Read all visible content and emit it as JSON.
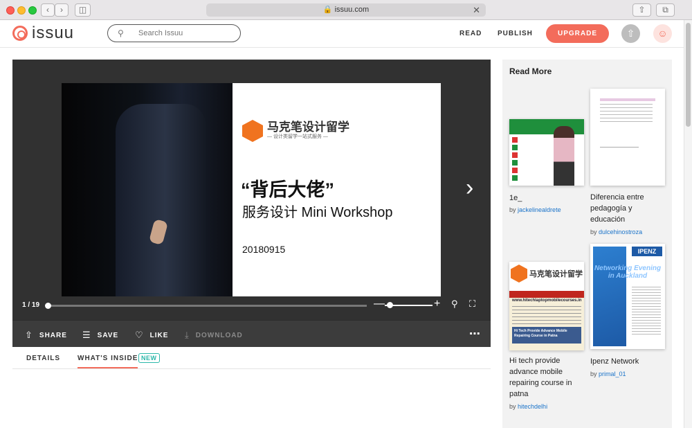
{
  "browser": {
    "url": "issuu.com",
    "lock_icon": "lock-icon"
  },
  "header": {
    "logo": "issuu",
    "search_placeholder": "Search Issuu",
    "nav_read": "READ",
    "nav_publish": "PUBLISH",
    "upgrade_label": "UPGRADE",
    "accent": "#f36c5b"
  },
  "viewer": {
    "slide_brand_title": "马克笔设计留学",
    "slide_brand_sub": "— 设计类留学一站式服务 —",
    "slide_title": "“背后大佬”",
    "slide_subtitle": "服务设计 Mini Workshop",
    "slide_date": "20180915",
    "page_counter": "1 / 19",
    "progress": 0.0
  },
  "toolbar": {
    "share": "SHARE",
    "save": "SAVE",
    "like": "LIKE",
    "download": "DOWNLOAD"
  },
  "tabs": {
    "details": "DETAILS",
    "whats_inside": "WHAT'S INSIDE",
    "new_badge": "NEW"
  },
  "read_more": {
    "heading": "Read More",
    "by_prefix": "by",
    "items": [
      {
        "title": "1e_",
        "author": "jackelinealdrete"
      },
      {
        "title": "Diferencia entre pedagogía y educación",
        "author": "dulcehinostroza"
      },
      {
        "title": "Hi tech provide advance mobile repairing course in patna",
        "author": "hitechdelhi",
        "thumb_top": "马克笔设计留学",
        "thumb_url": "www.hitechlaptopmobilecourses.in",
        "thumb_banner": "Hi Tech Provide Advance Mobile Repairing Course in Patna"
      },
      {
        "title": "Ipenz Network",
        "author": "primal_01",
        "thumb_head": "IPENZ",
        "thumb_text": "Networking Evening in Auckland"
      }
    ]
  }
}
